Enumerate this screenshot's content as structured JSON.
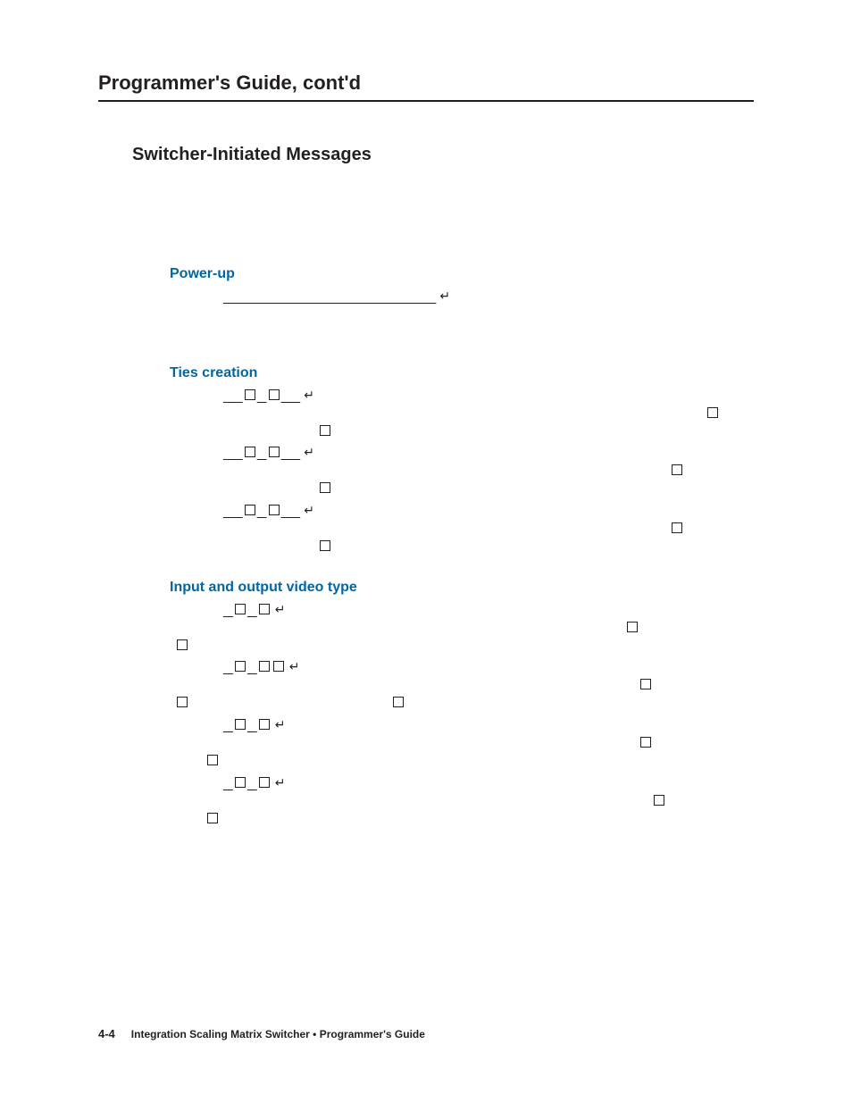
{
  "running_head": "Programmer's Guide, cont'd",
  "section_heading": "Switcher-Initiated Messages",
  "powerup": {
    "heading": "Power-up"
  },
  "ties": {
    "heading": "Ties creation"
  },
  "iovideo": {
    "heading": "Input and output video type"
  },
  "footer": {
    "page": "4-4",
    "title": "Integration Scaling Matrix Switcher • Programmer's Guide"
  },
  "glyphs": {
    "cr": "↵"
  }
}
